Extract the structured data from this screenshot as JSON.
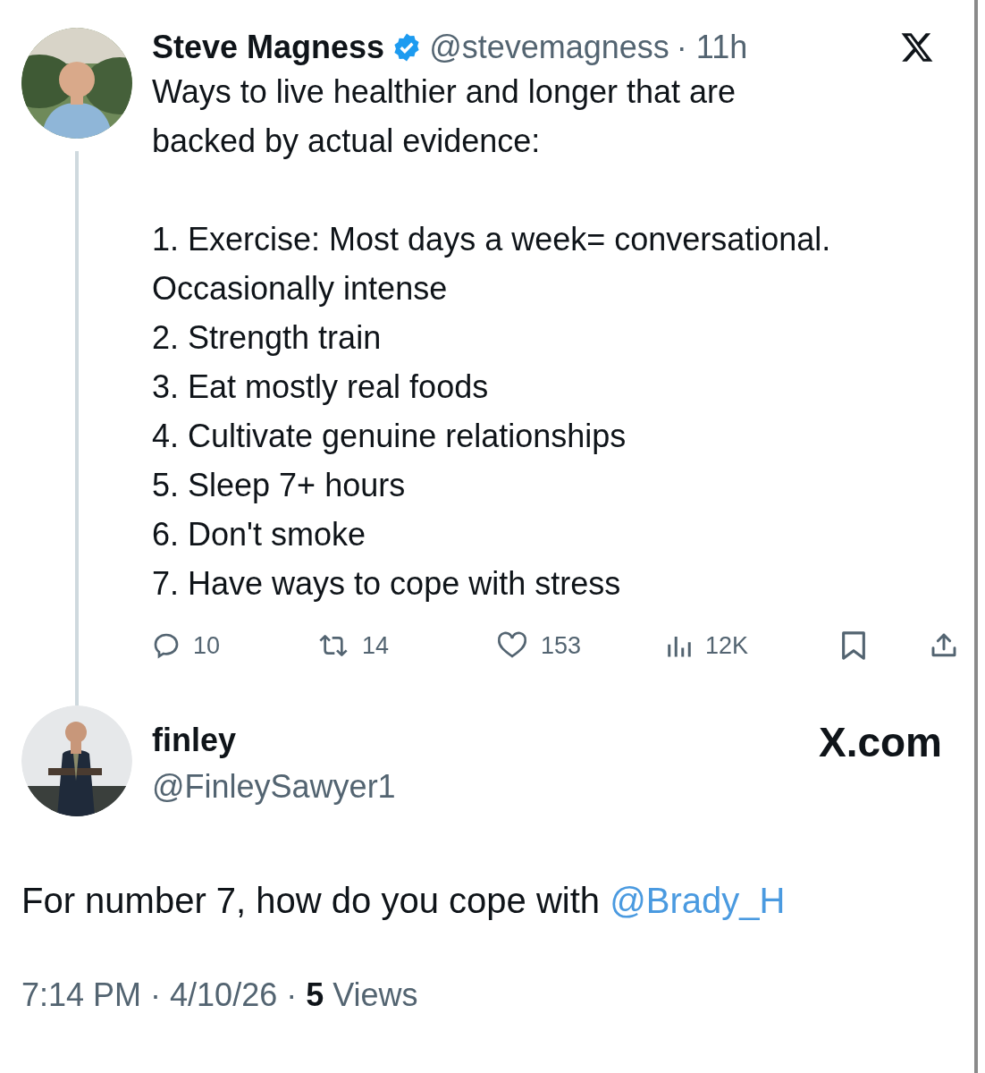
{
  "tweet": {
    "author": {
      "name": "Steve Magness",
      "verified": true,
      "handle": "@stevemagness",
      "time": "· 11h"
    },
    "intro": "Ways to live healthier and longer that are backed by actual evidence:",
    "items": [
      "1. Exercise: Most days a week= conversational. Occasionally intense",
      "2. Strength train",
      "3. Eat mostly real foods",
      "4. Cultivate genuine relationships",
      "5. Sleep 7+ hours",
      "6. Don't smoke",
      "7. Have ways to cope with stress"
    ],
    "actions": [
      {
        "kind": "reply",
        "count": "10"
      },
      {
        "kind": "repost",
        "count": "14"
      },
      {
        "kind": "like",
        "count": "153"
      },
      {
        "kind": "views",
        "count": "12K"
      },
      {
        "kind": "bookmark"
      },
      {
        "kind": "share"
      }
    ]
  },
  "reply": {
    "author": {
      "name": "finley",
      "handle": "@FinleySawyer1"
    },
    "brand": "X.com",
    "text": "For number 7, how do you cope with",
    "mention": "@Brady_H",
    "footer": "7:14 PM · 4/10/26 · **5** Views"
  }
}
